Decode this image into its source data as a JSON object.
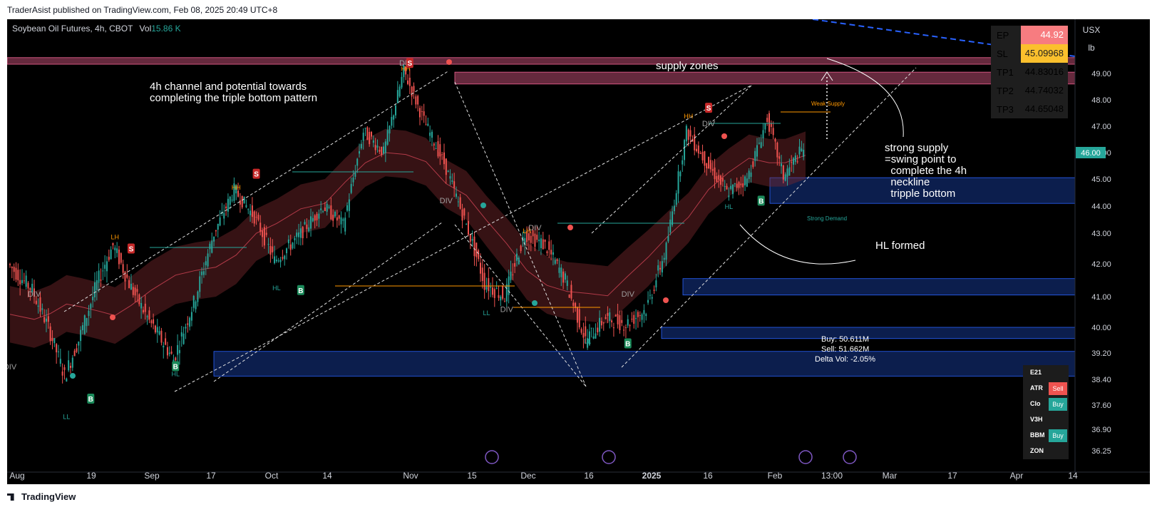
{
  "publisher": "TraderAsist published on TradingView.com, Feb 08, 2025 20:49 UTC+8",
  "symbol": {
    "name": "Soybean Oil Futures, 4h, CBOT",
    "vol_label": "Vol",
    "vol_value": "15.86 K"
  },
  "units": {
    "currency": "USX",
    "unit": "lb"
  },
  "footer_brand": "TradingView",
  "colors": {
    "up": "#26a69a",
    "down": "#ef5350",
    "supply": "#f06292",
    "demand": "#2962ff",
    "last_price": "#26a69a"
  },
  "trade_panel": [
    {
      "key": "EP",
      "value": "44.92",
      "bg": "#f77c80"
    },
    {
      "key": "SL",
      "value": "45.09968",
      "bg": "#fbc02d"
    },
    {
      "key": "TP1",
      "value": "44.83016",
      "bg": "#1e1e1e"
    },
    {
      "key": "TP2",
      "value": "44.74032",
      "bg": "#1e1e1e"
    },
    {
      "key": "TP3",
      "value": "44.65048",
      "bg": "#1e1e1e"
    }
  ],
  "indicator_panel": [
    {
      "key": "E21",
      "signal": ""
    },
    {
      "key": "ATR",
      "signal": "Sell"
    },
    {
      "key": "Clo",
      "signal": "Buy"
    },
    {
      "key": "V3H",
      "signal": ""
    },
    {
      "key": "BBM",
      "signal": "Buy"
    },
    {
      "key": "ZON",
      "signal": ""
    }
  ],
  "annotations": {
    "channel": "4h channel and potential towards\ncompleting the triple bottom pattern",
    "supply_zones": "supply zones",
    "strong_supply": "strong supply\n=swing point to\n  complete the 4h\n  neckline\n  tripple bottom",
    "hl_formed": "HL formed",
    "weak_supply": "Weak Supply",
    "strong_demand": "Strong Demand",
    "buy_vol": "Buy: 50.611M",
    "sell_vol": "Sell: 51.662M",
    "delta_vol": "Delta Vol: -2.05%"
  },
  "chart_data": {
    "type": "candlestick",
    "title": "Soybean Oil Futures, 4h, CBOT",
    "y_ticks": [
      49.0,
      48.0,
      47.0,
      46.0,
      45.0,
      44.0,
      43.0,
      42.0,
      41.0,
      40.0,
      39.2,
      38.4,
      37.6,
      36.9,
      36.25
    ],
    "y_tick_labels": [
      "49.00",
      "48.00",
      "47.00",
      "46.00",
      "45.00",
      "44.00",
      "43.00",
      "42.00",
      "41.00",
      "40.00",
      "39.20",
      "38.40",
      "37.60",
      "36.90",
      "36.25"
    ],
    "x_tick_labels": [
      "Aug",
      "19",
      "Sep",
      "17",
      "Oct",
      "14",
      "Nov",
      "15",
      "Dec",
      "16",
      "2025",
      "16",
      "Feb",
      "13:00",
      "Mar",
      "17",
      "Apr",
      "14"
    ],
    "last_price": "46.00",
    "price_path": [
      [
        0,
        42.0
      ],
      [
        12,
        41.2
      ],
      [
        20,
        40.0
      ],
      [
        28,
        38.5
      ],
      [
        35,
        39.6
      ],
      [
        44,
        41.4
      ],
      [
        52,
        42.6
      ],
      [
        60,
        41.4
      ],
      [
        70,
        40.2
      ],
      [
        82,
        39.0
      ],
      [
        92,
        40.8
      ],
      [
        102,
        43.0
      ],
      [
        112,
        44.6
      ],
      [
        122,
        43.6
      ],
      [
        132,
        42.1
      ],
      [
        144,
        42.9
      ],
      [
        156,
        44.0
      ],
      [
        166,
        43.3
      ],
      [
        176,
        46.8
      ],
      [
        186,
        46.0
      ],
      [
        196,
        49.1
      ],
      [
        206,
        47.2
      ],
      [
        216,
        45.6
      ],
      [
        226,
        43.5
      ],
      [
        236,
        41.4
      ],
      [
        246,
        41.0
      ],
      [
        256,
        43.0
      ],
      [
        266,
        42.6
      ],
      [
        276,
        41.5
      ],
      [
        286,
        39.6
      ],
      [
        296,
        40.3
      ],
      [
        306,
        40.1
      ],
      [
        316,
        40.6
      ],
      [
        326,
        42.5
      ],
      [
        336,
        46.8
      ],
      [
        346,
        45.6
      ],
      [
        356,
        44.5
      ],
      [
        366,
        45.0
      ],
      [
        376,
        47.3
      ],
      [
        384,
        45.1
      ],
      [
        394,
        46.2
      ]
    ],
    "zones": [
      {
        "type": "supply",
        "top": 49.6,
        "bottom": 49.35
      },
      {
        "type": "supply",
        "top": 49.05,
        "bottom": 48.6
      },
      {
        "type": "demand",
        "top": 45.05,
        "bottom": 44.1
      },
      {
        "type": "demand",
        "top": 41.55,
        "bottom": 41.05
      },
      {
        "type": "demand",
        "top": 40.0,
        "bottom": 39.65
      },
      {
        "type": "demand",
        "top": 39.25,
        "bottom": 38.5
      }
    ],
    "markers": [
      {
        "label": "DIV",
        "x": 12,
        "price": 41.0
      },
      {
        "label": "DIV",
        "x": 0,
        "price": 38.7
      },
      {
        "label": "LH",
        "x": 52,
        "price": 42.8
      },
      {
        "label": "HH",
        "x": 112,
        "price": 44.6
      },
      {
        "label": "DIV",
        "x": 196,
        "price": 49.3
      },
      {
        "label": "HH",
        "x": 196,
        "price": 49.1
      },
      {
        "label": "DIV",
        "x": 216,
        "price": 44.1
      },
      {
        "label": "LH",
        "x": 256,
        "price": 43.0
      },
      {
        "label": "DIV",
        "x": 260,
        "price": 43.1
      },
      {
        "label": "DIV",
        "x": 246,
        "price": 40.5
      },
      {
        "label": "DIV",
        "x": 306,
        "price": 41.0
      },
      {
        "label": "HH",
        "x": 336,
        "price": 47.3
      },
      {
        "label": "DIV",
        "x": 346,
        "price": 47.0
      },
      {
        "label": "LL",
        "x": 28,
        "price": 37.2
      },
      {
        "label": "HL",
        "x": 82,
        "price": 38.5
      },
      {
        "label": "HL",
        "x": 132,
        "price": 41.2
      },
      {
        "label": "LL",
        "x": 236,
        "price": 40.4
      },
      {
        "label": "LL",
        "x": 286,
        "price": 39.5
      },
      {
        "label": "HL",
        "x": 356,
        "price": 43.9
      }
    ],
    "signals": [
      {
        "label": "S",
        "x": 60,
        "price": 42.5
      },
      {
        "label": "B",
        "x": 40,
        "price": 37.8
      },
      {
        "label": "B",
        "x": 82,
        "price": 38.8
      },
      {
        "label": "S",
        "x": 122,
        "price": 45.2
      },
      {
        "label": "B",
        "x": 144,
        "price": 41.2
      },
      {
        "label": "S",
        "x": 198,
        "price": 49.4
      },
      {
        "label": "B",
        "x": 306,
        "price": 39.5
      },
      {
        "label": "S",
        "x": 346,
        "price": 47.7
      },
      {
        "label": "B",
        "x": 372,
        "price": 44.2
      }
    ]
  }
}
